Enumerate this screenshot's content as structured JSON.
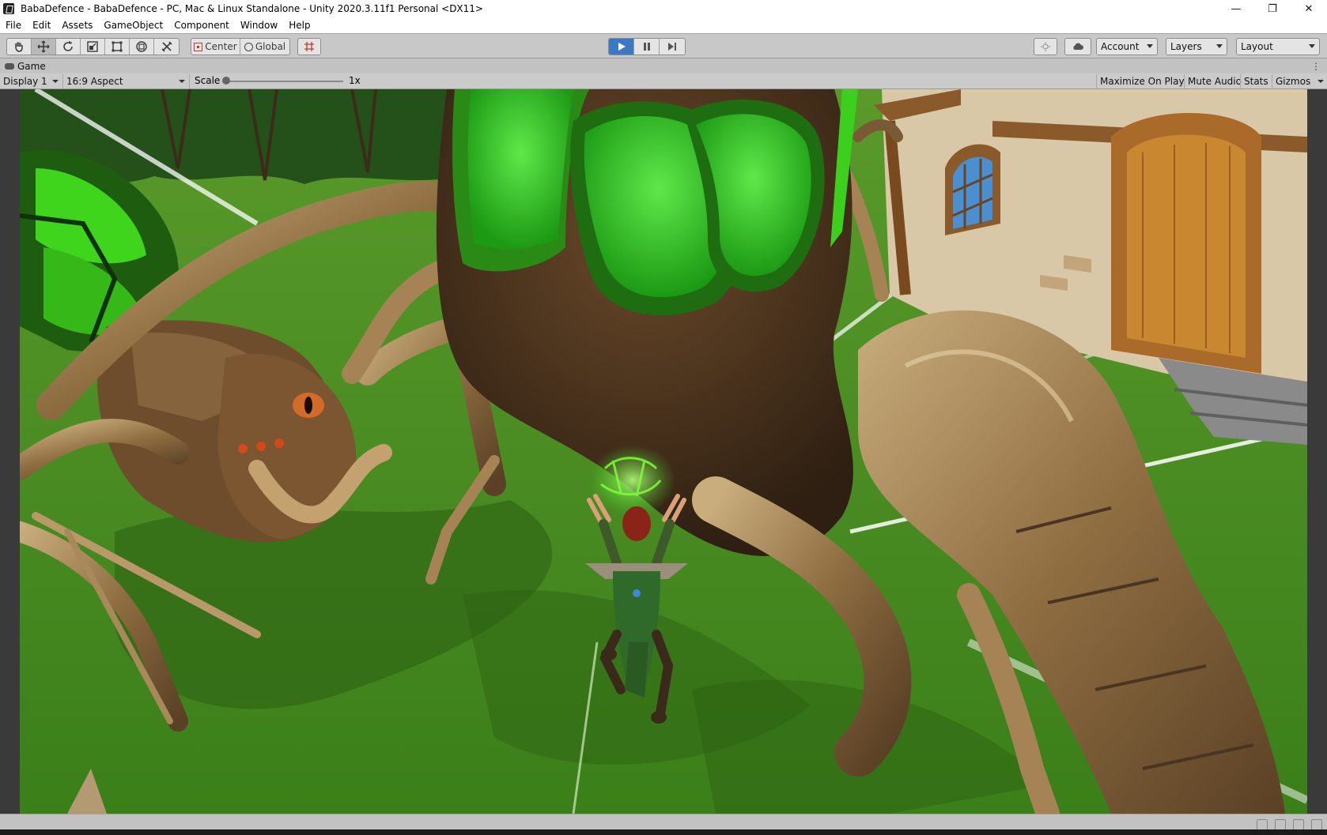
{
  "window": {
    "title": "BabaDefence - BabaDefence - PC, Mac & Linux Standalone - Unity 2020.3.11f1 Personal <DX11>",
    "controls": {
      "minimize": "—",
      "restore": "❐",
      "close": "✕"
    }
  },
  "menu": {
    "items": [
      "File",
      "Edit",
      "Assets",
      "GameObject",
      "Component",
      "Window",
      "Help"
    ]
  },
  "toolbar": {
    "tools": [
      "hand-tool",
      "move-tool",
      "rotate-tool",
      "scale-tool",
      "rect-tool",
      "transform-tool",
      "custom-tool"
    ],
    "active_tool": "move-tool",
    "pivot_label": "Center",
    "space_label": "Global",
    "snap_icon": "grid-snap",
    "playback": {
      "play": "▶",
      "pause": "❚❚",
      "step": "▶|",
      "is_playing": true
    },
    "account_label": "Account",
    "layers_label": "Layers",
    "layout_label": "Layout"
  },
  "game_tab": {
    "label": "Game"
  },
  "game_controls": {
    "display_label": "Display 1",
    "aspect_label": "16:9 Aspect",
    "scale_label": "Scale",
    "scale_value": "1x",
    "maximize_label": "Maximize On Play",
    "mute_label": "Mute Audio",
    "stats_label": "Stats",
    "gizmos_label": "Gizmos"
  },
  "colors": {
    "play_active": "#3d78c4",
    "grass": "#3f8a1e",
    "spider_green": "#39c21e",
    "spider_brown": "#7a5a35"
  }
}
